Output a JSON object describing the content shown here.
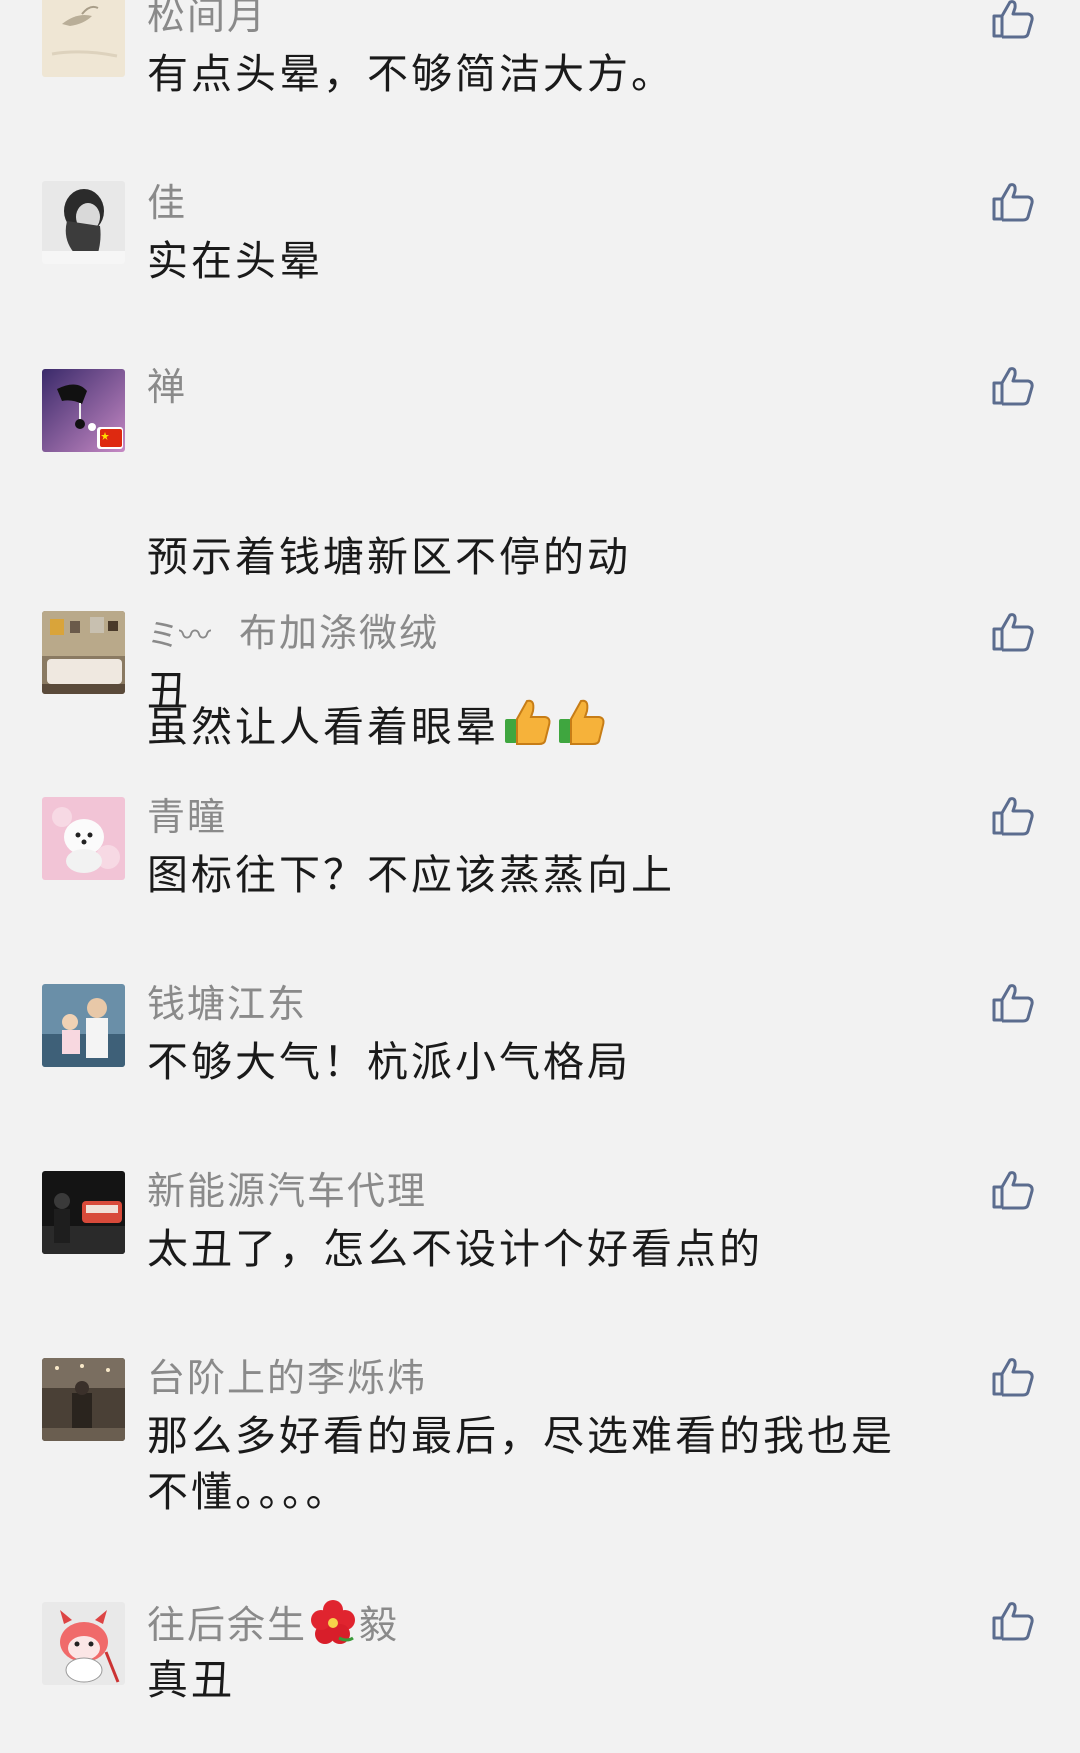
{
  "comments": [
    {
      "name": "松间月",
      "text": "有点头晕，不够简洁大方。",
      "avatar_icon": "sketch-avatar-icon",
      "like_icon": "thumbs-up-icon"
    },
    {
      "name": "佳",
      "text": "实在头晕",
      "avatar_icon": "girl-portrait-avatar-icon",
      "like_icon": "thumbs-up-icon"
    },
    {
      "name": "禅",
      "text_line1": "预示着钱塘新区不停的动",
      "text_line2": "虽然让人看着眼晕",
      "emoji": "thumbs-up-emoji",
      "avatar_icon": "purple-hand-avatar-icon",
      "badge": "china-flag-icon",
      "like_icon": "thumbs-up-icon"
    },
    {
      "name_symbol": "ミ〰",
      "name": "布加涤微绒",
      "text": "丑",
      "avatar_icon": "bedroom-avatar-icon",
      "like_icon": "thumbs-up-icon"
    },
    {
      "name": "青瞳",
      "text": "图标往下？不应该蒸蒸向上",
      "avatar_icon": "white-dog-avatar-icon",
      "like_icon": "thumbs-up-icon"
    },
    {
      "name": "钱塘江东",
      "text": "不够大气！杭派小气格局",
      "avatar_icon": "family-photo-avatar-icon",
      "like_icon": "thumbs-up-icon"
    },
    {
      "name": "新能源汽车代理",
      "text": "太丑了，怎么不设计个好看点的",
      "avatar_icon": "car-showroom-avatar-icon",
      "like_icon": "thumbs-up-icon"
    },
    {
      "name": "台阶上的李烁炜",
      "text": "那么多好看的最后，尽选难看的我也是不懂。。。。",
      "avatar_icon": "street-photo-avatar-icon",
      "like_icon": "thumbs-up-icon"
    },
    {
      "name_before": "往后余生",
      "name_after": "毅",
      "name_emoji": "hibiscus-flower-icon",
      "text": "真丑",
      "avatar_icon": "cartoon-devil-avatar-icon",
      "like_icon": "thumbs-up-icon"
    }
  ],
  "colors": {
    "background": "#f2f2f2",
    "name": "#8a8a8a",
    "text": "#1a1a1a",
    "like_icon": "#5b6c8e"
  }
}
